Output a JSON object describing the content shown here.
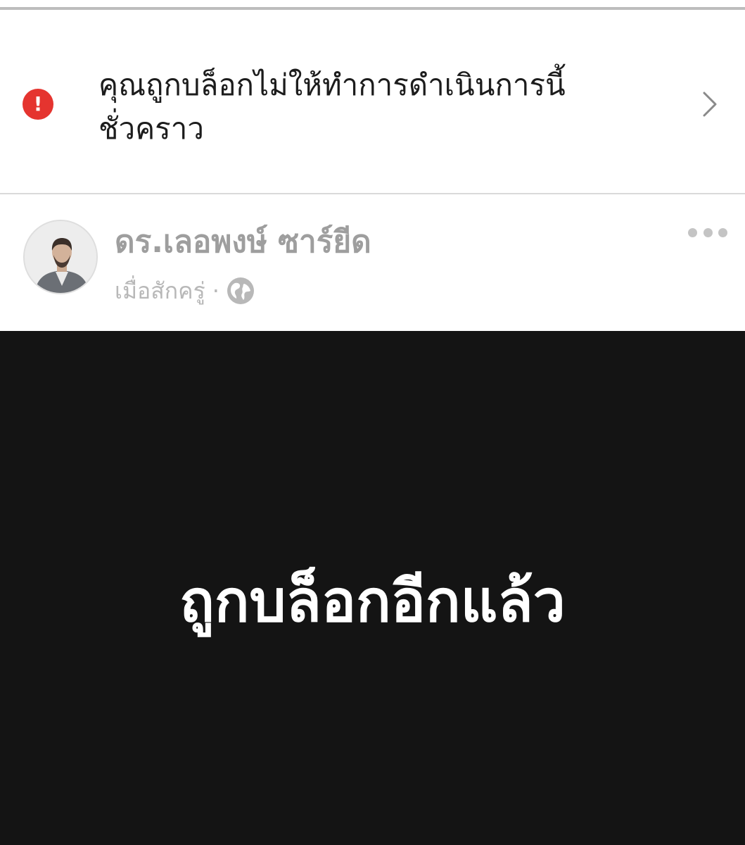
{
  "notice": {
    "icon": "alert-icon",
    "icon_glyph": "!",
    "icon_color": "#e5342f",
    "message": "คุณถูกบล็อกไม่ให้ทำการดำเนินการนี้ชั่วคราว",
    "chevron_icon": "chevron-right-icon"
  },
  "post": {
    "author_name": "ดร.เลอพงษ์ ซาร์ยีด",
    "timestamp": "เมื่อสักครู่",
    "separator": "·",
    "privacy_icon": "globe-icon",
    "more_icon": "more-horizontal-icon",
    "image_text": "ถูกบล็อกอีกแล้ว",
    "image_background": "#141414"
  }
}
